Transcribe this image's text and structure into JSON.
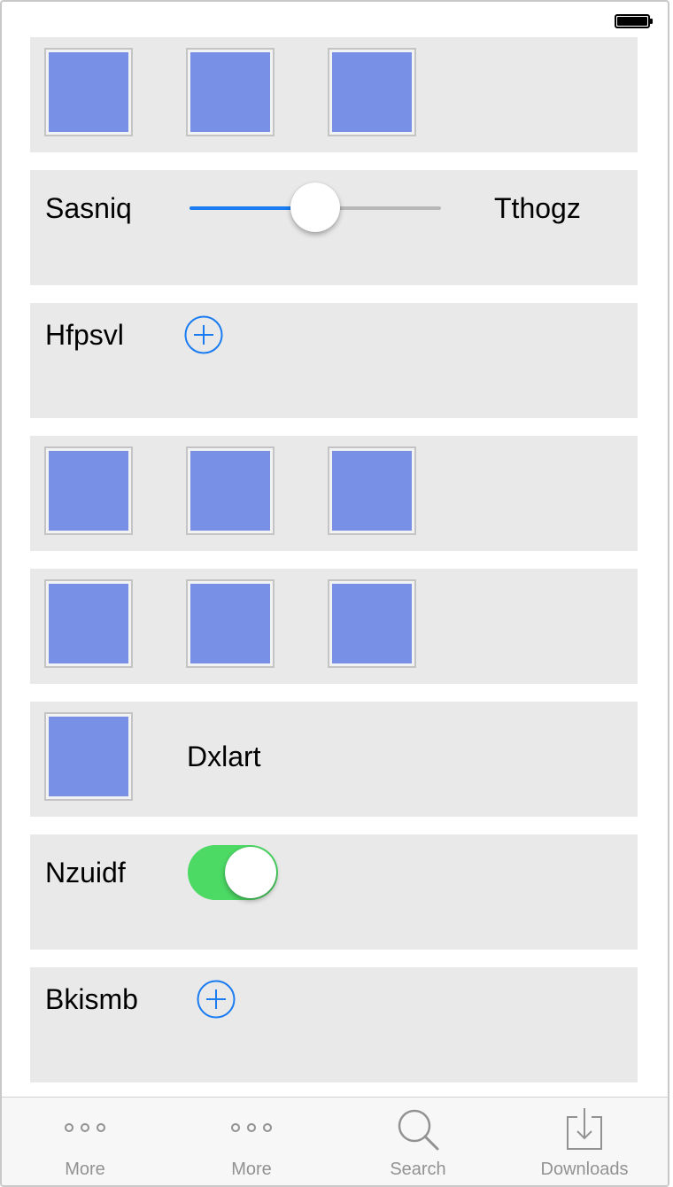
{
  "status_bar": {
    "battery": "battery-icon"
  },
  "rows": [
    {
      "type": "image-row",
      "images": [
        "image-placeholder",
        "image-placeholder",
        "image-placeholder"
      ]
    },
    {
      "type": "slider",
      "left_label": "Sasniq",
      "right_label": "Tthogz",
      "value": 0.5,
      "accent": "#1a7cf0"
    },
    {
      "type": "add",
      "label": "Hfpsvl",
      "icon": "plus-circle-icon"
    },
    {
      "type": "image-row",
      "images": [
        "image-placeholder",
        "image-placeholder",
        "image-placeholder"
      ]
    },
    {
      "type": "image-row",
      "images": [
        "image-placeholder",
        "image-placeholder",
        "image-placeholder"
      ]
    },
    {
      "type": "image-text",
      "label": "Dxlart",
      "image": "image-placeholder"
    },
    {
      "type": "toggle",
      "label": "Nzuidf",
      "on": true,
      "color": "#4cd964"
    },
    {
      "type": "add",
      "label": "Bkismb",
      "icon": "plus-circle-icon"
    }
  ],
  "tabbar": {
    "tabs": [
      {
        "label": "More",
        "icon": "more-icon"
      },
      {
        "label": "More",
        "icon": "more-icon"
      },
      {
        "label": "Search",
        "icon": "search-icon"
      },
      {
        "label": "Downloads",
        "icon": "download-icon"
      }
    ]
  },
  "colors": {
    "image_fill": "#7890e6",
    "row_background": "#e9e9e9",
    "tab_label": "#929292"
  }
}
